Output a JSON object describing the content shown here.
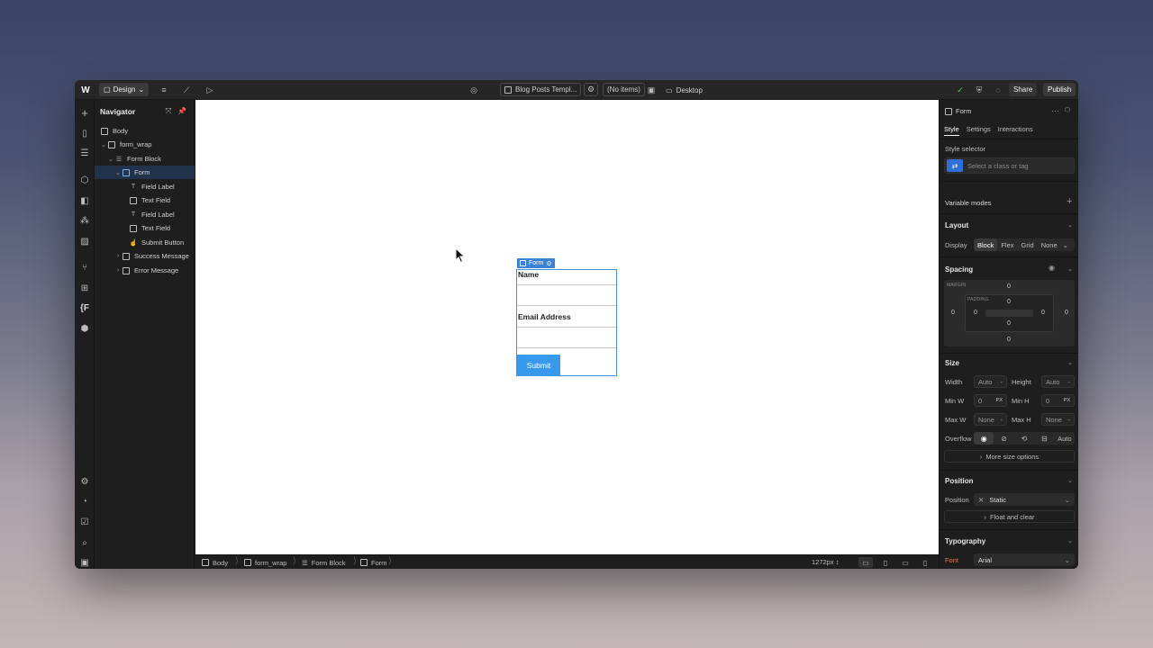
{
  "topbar": {
    "mode_label": "Design",
    "page_name": "Blog Posts Templ...",
    "items_label": "(No items)",
    "breakpoint_label": "Desktop",
    "share_label": "Share",
    "publish_label": "Publish"
  },
  "navigator": {
    "title": "Navigator",
    "items": [
      {
        "label": "Body",
        "icon": "body-icon"
      },
      {
        "label": "form_wrap",
        "icon": "div-icon"
      },
      {
        "label": "Form Block",
        "icon": "form-block-icon"
      },
      {
        "label": "Form",
        "icon": "form-icon"
      },
      {
        "label": "Field Label",
        "icon": "text-icon"
      },
      {
        "label": "Text Field",
        "icon": "input-icon"
      },
      {
        "label": "Field Label",
        "icon": "text-icon"
      },
      {
        "label": "Text Field",
        "icon": "input-icon"
      },
      {
        "label": "Submit Button",
        "icon": "pointer-icon"
      },
      {
        "label": "Success Message",
        "icon": "div-icon"
      },
      {
        "label": "Error Message",
        "icon": "div-icon"
      }
    ]
  },
  "canvas": {
    "selection_tag": "Form",
    "form": {
      "name_label": "Name",
      "email_label": "Email Address",
      "submit_label": "Submit"
    }
  },
  "bottombar": {
    "crumbs": [
      "Body",
      "form_wrap",
      "Form Block",
      "Form"
    ],
    "width_readout": "1272px"
  },
  "panel": {
    "element_name": "Form",
    "tabs": [
      "Style",
      "Settings",
      "Interactions"
    ],
    "style_selector_label": "Style selector",
    "style_selector_placeholder": "Select a class or tag",
    "variable_modes_label": "Variable modes",
    "layout": {
      "title": "Layout",
      "display_label": "Display",
      "options": [
        "Block",
        "Flex",
        "Grid",
        "None"
      ],
      "active": "Block"
    },
    "spacing": {
      "title": "Spacing",
      "margin_caption": "MARGIN",
      "padding_caption": "PADDING",
      "margin": {
        "top": "0",
        "right": "0",
        "bottom": "0",
        "left": "0"
      },
      "padding": {
        "top": "0",
        "right": "0",
        "bottom": "0",
        "left": "0"
      }
    },
    "size": {
      "title": "Size",
      "width_label": "Width",
      "width_value": "Auto",
      "height_label": "Height",
      "height_value": "Auto",
      "minw_label": "Min W",
      "minw_value": "0",
      "minw_unit": "PX",
      "minh_label": "Min H",
      "minh_value": "0",
      "minh_unit": "PX",
      "maxw_label": "Max W",
      "maxw_value": "None",
      "maxh_label": "Max H",
      "maxh_value": "None",
      "overflow_label": "Overflow",
      "overflow_auto": "Auto",
      "more_label": "More size options"
    },
    "position": {
      "title": "Position",
      "position_label": "Position",
      "value": "Static",
      "float_label": "Float and clear"
    },
    "typography": {
      "title": "Typography",
      "font_label": "Font",
      "font_value": "Arial"
    }
  },
  "colors": {
    "accent": "#3b82d6",
    "submit": "#3898ec",
    "font_label": "#e07b53"
  }
}
